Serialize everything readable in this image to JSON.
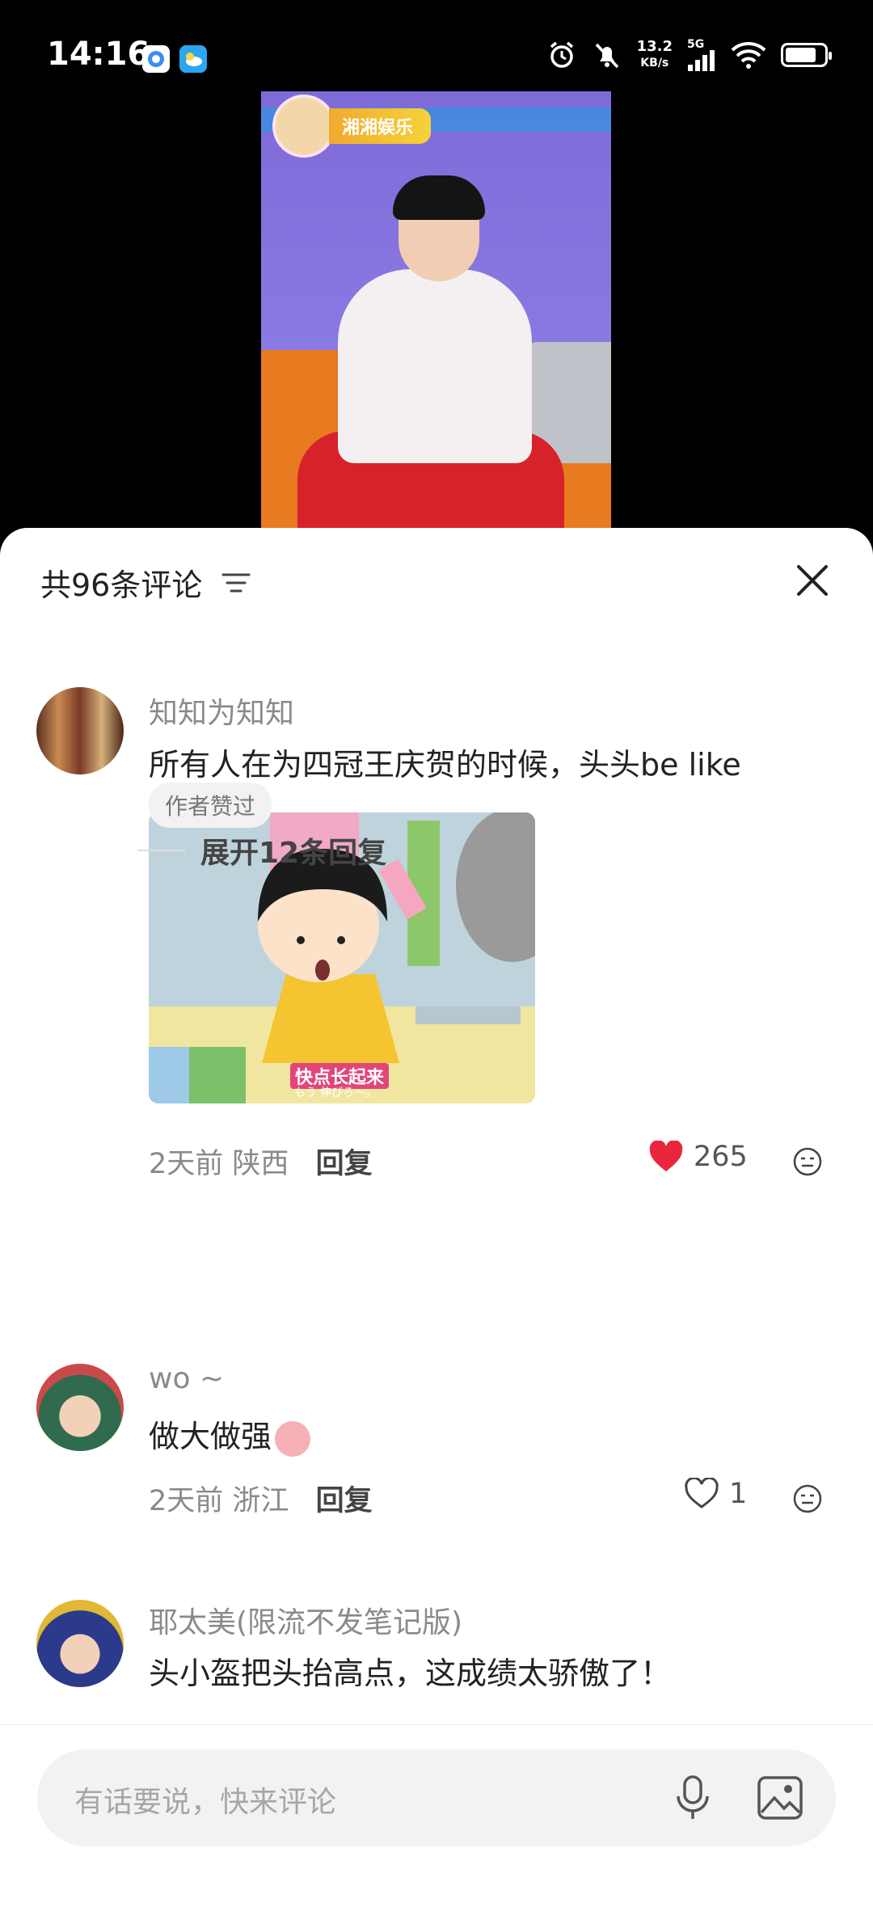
{
  "status_bar": {
    "time": "14:16",
    "net_speed_value": "13.2",
    "net_speed_unit": "KB/s",
    "network": "5G",
    "icons": [
      "alarm-icon",
      "mute-icon",
      "signal-icon",
      "wifi-icon",
      "battery-icon"
    ]
  },
  "video": {
    "channel_name": "湘湘娱乐"
  },
  "panel": {
    "title": "共96条评论"
  },
  "comments": [
    {
      "author": "知知为知知",
      "text": "所有人在为四冠王庆贺的时候，头头be like",
      "meme_caption": "快点长起来",
      "meme_subcaption": "もう 伸びろ〜。",
      "time": "2天前",
      "location": "陕西",
      "reply_label": "回复",
      "likes": "265",
      "liked": true,
      "badge": "作者赞过",
      "expand_label": "展开12条回复"
    },
    {
      "author": "wo ~",
      "text": "做大做强",
      "time": "2天前",
      "location": "浙江",
      "reply_label": "回复",
      "likes": "1",
      "liked": false
    },
    {
      "author": "耶太美(限流不发笔记版)",
      "text": "头小盔把头抬高点，这成绩太骄傲了！"
    }
  ],
  "input": {
    "placeholder": "有话要说，快来评论"
  },
  "colors": {
    "like_red": "#e8263c",
    "text_gray": "#8a8a8a"
  }
}
